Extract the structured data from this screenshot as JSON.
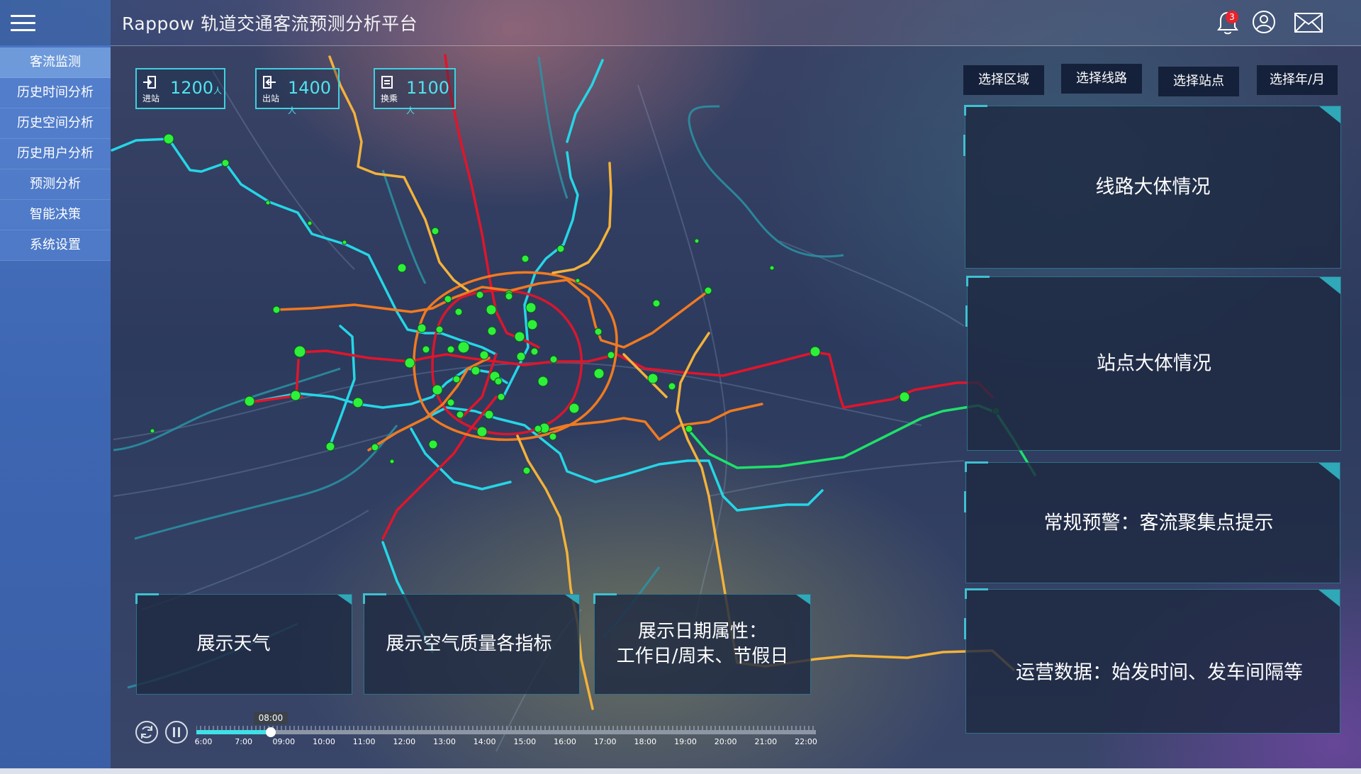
{
  "header": {
    "title": "Rappow 轨道交通客流预测分析平台",
    "notification_count": "3",
    "icons": [
      "menu-icon",
      "bell-icon",
      "user-icon",
      "mail-icon"
    ]
  },
  "sidebar": {
    "items": [
      {
        "label": "客流监测",
        "active": true
      },
      {
        "label": "历史时间分析",
        "active": false
      },
      {
        "label": "历史空间分析",
        "active": false
      },
      {
        "label": "历史用户分析",
        "active": false
      },
      {
        "label": "预测分析",
        "active": false
      },
      {
        "label": "智能决策",
        "active": false
      },
      {
        "label": "系统设置",
        "active": false
      }
    ]
  },
  "stats": [
    {
      "label": "进站",
      "value": "1200",
      "unit": "人",
      "icon": "enter-icon"
    },
    {
      "label": "出站",
      "value": "1400",
      "unit": "人",
      "icon": "exit-icon"
    },
    {
      "label": "换乘",
      "value": "1100",
      "unit": "人",
      "icon": "transfer-icon"
    }
  ],
  "selectors": [
    {
      "label": "选择区域"
    },
    {
      "label": "选择线路"
    },
    {
      "label": "选择站点"
    },
    {
      "label": "选择年/月"
    }
  ],
  "right_panels": [
    {
      "text": "线路大体情况"
    },
    {
      "text": "站点大体情况"
    },
    {
      "text": "常规预警：客流聚集点提示"
    },
    {
      "text": "运营数据：始发时间、发车间隔等"
    }
  ],
  "bottom_panels": [
    {
      "text": "展示天气"
    },
    {
      "text": "展示空气质量各指标"
    },
    {
      "text": "展示日期属性：\n工作日/周末、节假日"
    }
  ],
  "timeline": {
    "current_time": "08:00",
    "progress": 0.12,
    "labels": [
      "6:00",
      "7:00",
      "09:00",
      "10:00",
      "11:00",
      "12:00",
      "13:00",
      "14:00",
      "15:00",
      "16:00",
      "17:00",
      "18:00",
      "19:00",
      "20:00",
      "21:00",
      "22:00"
    ]
  },
  "colors": {
    "accent_cyan": "#3fd0e0",
    "line_red": "#e0152b",
    "line_orange": "#f07a20",
    "line_yellow": "#f3b23a",
    "line_cyan": "#25d6e6",
    "line_green": "#1fe06a",
    "station_green": "#2ef03a",
    "badge_red": "#e8232b"
  }
}
